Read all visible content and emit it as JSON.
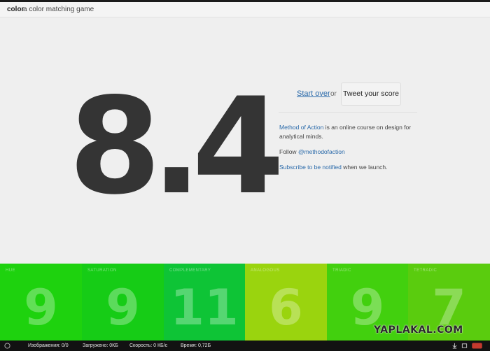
{
  "header": {
    "brand": "color",
    "tagline": "a color matching game"
  },
  "score": "8.4",
  "actions": {
    "start_over": "Start over",
    "or": "or",
    "tweet": "Tweet your score"
  },
  "info": {
    "course_link": "Method of Action",
    "course_text": " is an online course on design for analytical minds.",
    "follow_prefix": "Follow ",
    "follow_handle": "@methodofaction",
    "subscribe_link": "Subscribe to be notified",
    "subscribe_suffix": " when we launch."
  },
  "tiles": [
    {
      "label": "HUE",
      "value": "9",
      "color": "#1ed20e"
    },
    {
      "label": "SATURATION",
      "value": "9",
      "color": "#16cc16"
    },
    {
      "label": "COMPLEMENTARY",
      "value": "11",
      "color": "#0ec436"
    },
    {
      "label": "ANALOGOUS",
      "value": "6",
      "color": "#9ad40e"
    },
    {
      "label": "TRIADIC",
      "value": "9",
      "color": "#42d00e"
    },
    {
      "label": "TETRADIC",
      "value": "7",
      "color": "#5acc0e"
    }
  ],
  "watermark": "YAPLAKAL.COM",
  "statusbar": {
    "images": "Изображения: 0/0",
    "loaded": "Загружено: 0КБ",
    "speed": "Скорость: 0 КБ/с",
    "time": "Время: 0,72Б"
  }
}
